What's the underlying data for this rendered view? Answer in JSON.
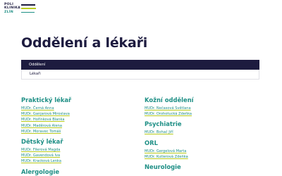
{
  "logo": {
    "lines": [
      "POLI",
      "KLINIKA",
      "ZLÍN"
    ]
  },
  "page_title": "Oddělení a lékaři",
  "tabs": [
    {
      "label": "Oddělení",
      "active": true
    },
    {
      "label": "Lékaři",
      "active": false
    }
  ],
  "departments_left": [
    {
      "name": "Praktický lékař",
      "doctors": [
        "MUDr. Černá Anna",
        "MUDr. Ganjarová Miroslava",
        "MUDr. Hořínková Blanka",
        "MUDr. Maděrová Alena",
        "MUDr. Moravec Tomáš"
      ]
    },
    {
      "name": "Dětský lékař",
      "doctors": [
        "MUDr. Filerová Magda",
        "MUDr. Gavendová Iva",
        "MUDr. Kracková Lenka"
      ]
    },
    {
      "name": "Alergologie",
      "doctors": []
    }
  ],
  "departments_right": [
    {
      "name": "Kožní oddělení",
      "doctors": [
        "MUDr. Nečasová Světlana",
        "MUDr. Orohotucká Zdeňka"
      ]
    },
    {
      "name": "Psychiatrie",
      "doctors": [
        "MUDr. Bohač Jiří"
      ]
    },
    {
      "name": "ORL",
      "doctors": [
        "MUDr. Gergelová Marta",
        "MUDr. Kutlerová Zdeňka"
      ]
    },
    {
      "name": "Neurologie",
      "doctors": []
    }
  ],
  "colors": {
    "navy": "#1d1b3f",
    "teal": "#1e8f85",
    "lime": "#b9cc1e"
  }
}
